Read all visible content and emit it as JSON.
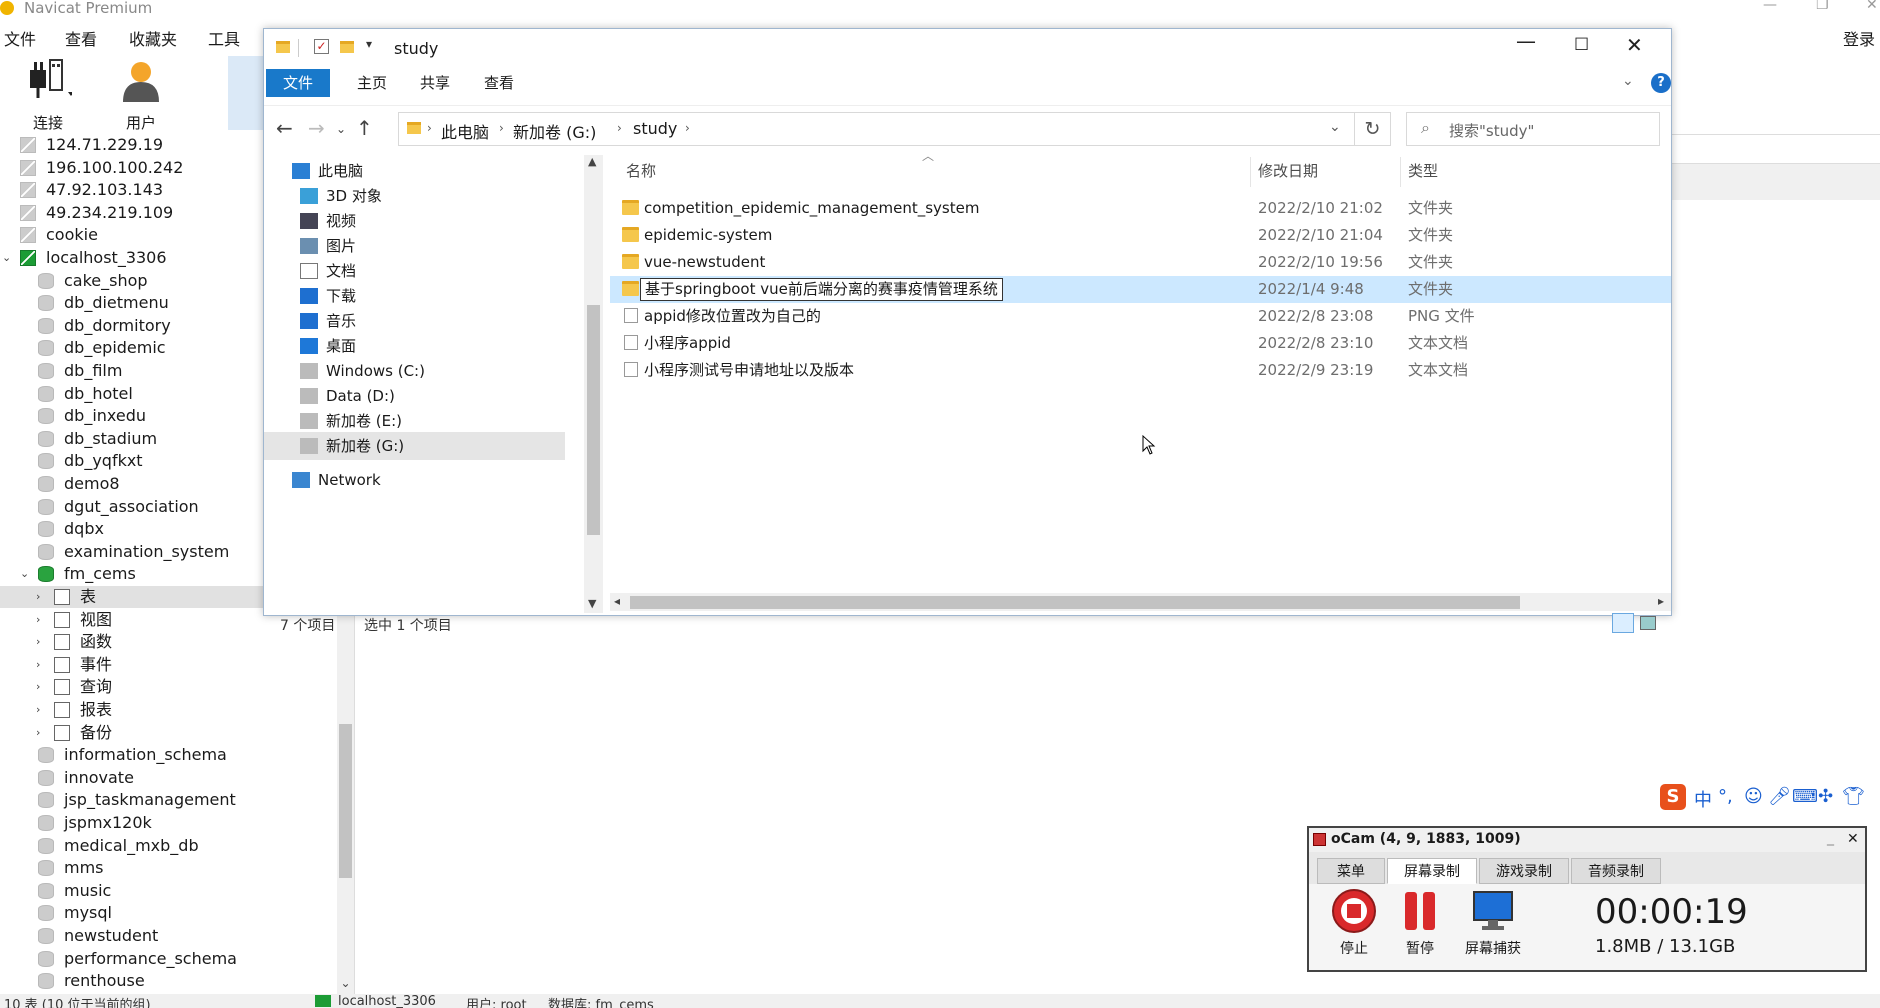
{
  "navicat": {
    "title": "Navicat Premium",
    "menu": [
      "文件",
      "查看",
      "收藏夹",
      "工具"
    ],
    "login": "登录",
    "toolbar": {
      "connect": "连接",
      "user": "用户"
    },
    "tree": [
      {
        "label": "124.71.229.19",
        "kind": "server"
      },
      {
        "label": "196.100.100.242",
        "kind": "server"
      },
      {
        "label": "47.92.103.143",
        "kind": "server"
      },
      {
        "label": "49.234.219.109",
        "kind": "server"
      },
      {
        "label": "cookie",
        "kind": "server"
      },
      {
        "label": "localhost_3306",
        "kind": "server-open"
      },
      {
        "label": "cake_shop",
        "kind": "db"
      },
      {
        "label": "db_dietmenu",
        "kind": "db"
      },
      {
        "label": "db_dormitory",
        "kind": "db"
      },
      {
        "label": "db_epidemic",
        "kind": "db"
      },
      {
        "label": "db_film",
        "kind": "db"
      },
      {
        "label": "db_hotel",
        "kind": "db"
      },
      {
        "label": "db_inxedu",
        "kind": "db"
      },
      {
        "label": "db_stadium",
        "kind": "db"
      },
      {
        "label": "db_yqfkxt",
        "kind": "db"
      },
      {
        "label": "demo8",
        "kind": "db"
      },
      {
        "label": "dgut_association",
        "kind": "db"
      },
      {
        "label": "dqbx",
        "kind": "db"
      },
      {
        "label": "examination_system",
        "kind": "db"
      },
      {
        "label": "fm_cems",
        "kind": "db-open"
      },
      {
        "label": "表",
        "kind": "obj"
      },
      {
        "label": "视图",
        "kind": "obj"
      },
      {
        "label": "函数",
        "kind": "obj"
      },
      {
        "label": "事件",
        "kind": "obj"
      },
      {
        "label": "查询",
        "kind": "obj"
      },
      {
        "label": "报表",
        "kind": "obj"
      },
      {
        "label": "备份",
        "kind": "obj"
      },
      {
        "label": "information_schema",
        "kind": "db"
      },
      {
        "label": "innovate",
        "kind": "db"
      },
      {
        "label": "jsp_taskmanagement",
        "kind": "db"
      },
      {
        "label": "jspmx120k",
        "kind": "db"
      },
      {
        "label": "medical_mxb_db",
        "kind": "db"
      },
      {
        "label": "mms",
        "kind": "db"
      },
      {
        "label": "music",
        "kind": "db"
      },
      {
        "label": "mysql",
        "kind": "db"
      },
      {
        "label": "newstudent",
        "kind": "db"
      },
      {
        "label": "performance_schema",
        "kind": "db"
      },
      {
        "label": "renthouse",
        "kind": "db"
      }
    ],
    "status": {
      "left": "10 表 (10 位于当前的组)",
      "conn": "localhost_3306",
      "user": "用户: root",
      "db": "数据库: fm_cems"
    }
  },
  "explorer": {
    "title": "study",
    "ribbon_tabs": [
      "文件",
      "主页",
      "共享",
      "查看"
    ],
    "help": "?",
    "breadcrumb": [
      "此电脑",
      "新加卷 (G:)",
      "study"
    ],
    "search_placeholder": "搜索\"study\"",
    "nav": [
      {
        "label": "此电脑",
        "icon": "pc-icon"
      },
      {
        "label": "3D 对象",
        "icon": "cube-icon"
      },
      {
        "label": "视频",
        "icon": "video-icon"
      },
      {
        "label": "图片",
        "icon": "picture-icon"
      },
      {
        "label": "文档",
        "icon": "document-icon"
      },
      {
        "label": "下载",
        "icon": "download-icon"
      },
      {
        "label": "音乐",
        "icon": "music-icon"
      },
      {
        "label": "桌面",
        "icon": "desktop-icon"
      },
      {
        "label": "Windows (C:)",
        "icon": "drive-icon"
      },
      {
        "label": "Data (D:)",
        "icon": "drive-icon"
      },
      {
        "label": "新加卷 (E:)",
        "icon": "drive-icon"
      },
      {
        "label": "新加卷 (G:)",
        "icon": "drive-icon"
      },
      {
        "label": "Network",
        "icon": "network-icon"
      }
    ],
    "columns": {
      "name": "名称",
      "date": "修改日期",
      "type": "类型"
    },
    "files": [
      {
        "name": "competition_epidemic_management_system",
        "date": "2022/2/10 21:02",
        "type": "文件夹",
        "icon": "folder"
      },
      {
        "name": "epidemic-system",
        "date": "2022/2/10 21:04",
        "type": "文件夹",
        "icon": "folder"
      },
      {
        "name": "vue-newstudent",
        "date": "2022/2/10 19:56",
        "type": "文件夹",
        "icon": "folder"
      },
      {
        "name": "基于springboot vue前后端分离的赛事疫情管理系统",
        "date": "2022/1/4 9:48",
        "type": "文件夹",
        "icon": "folder"
      },
      {
        "name": "appid修改位置改为自己的",
        "date": "2022/2/8 23:08",
        "type": "PNG 文件",
        "icon": "png"
      },
      {
        "name": "小程序appid",
        "date": "2022/2/8 23:10",
        "type": "文本文档",
        "icon": "txt"
      },
      {
        "name": "小程序测试号申请地址以及版本",
        "date": "2022/2/9 23:19",
        "type": "文本文档",
        "icon": "txt"
      }
    ],
    "status": {
      "count": "7 个项目",
      "selected": "选中 1 个项目"
    }
  },
  "ocam": {
    "title": "oCam (4, 9, 1883, 1009)",
    "tabs": [
      "菜单",
      "屏幕录制",
      "游戏录制",
      "音频录制"
    ],
    "buttons": {
      "stop": "停止",
      "pause": "暂停",
      "capture": "屏幕捕获"
    },
    "timer": "00:00:19",
    "size": "1.8MB / 13.1GB"
  },
  "ime": {
    "mode": "中"
  }
}
